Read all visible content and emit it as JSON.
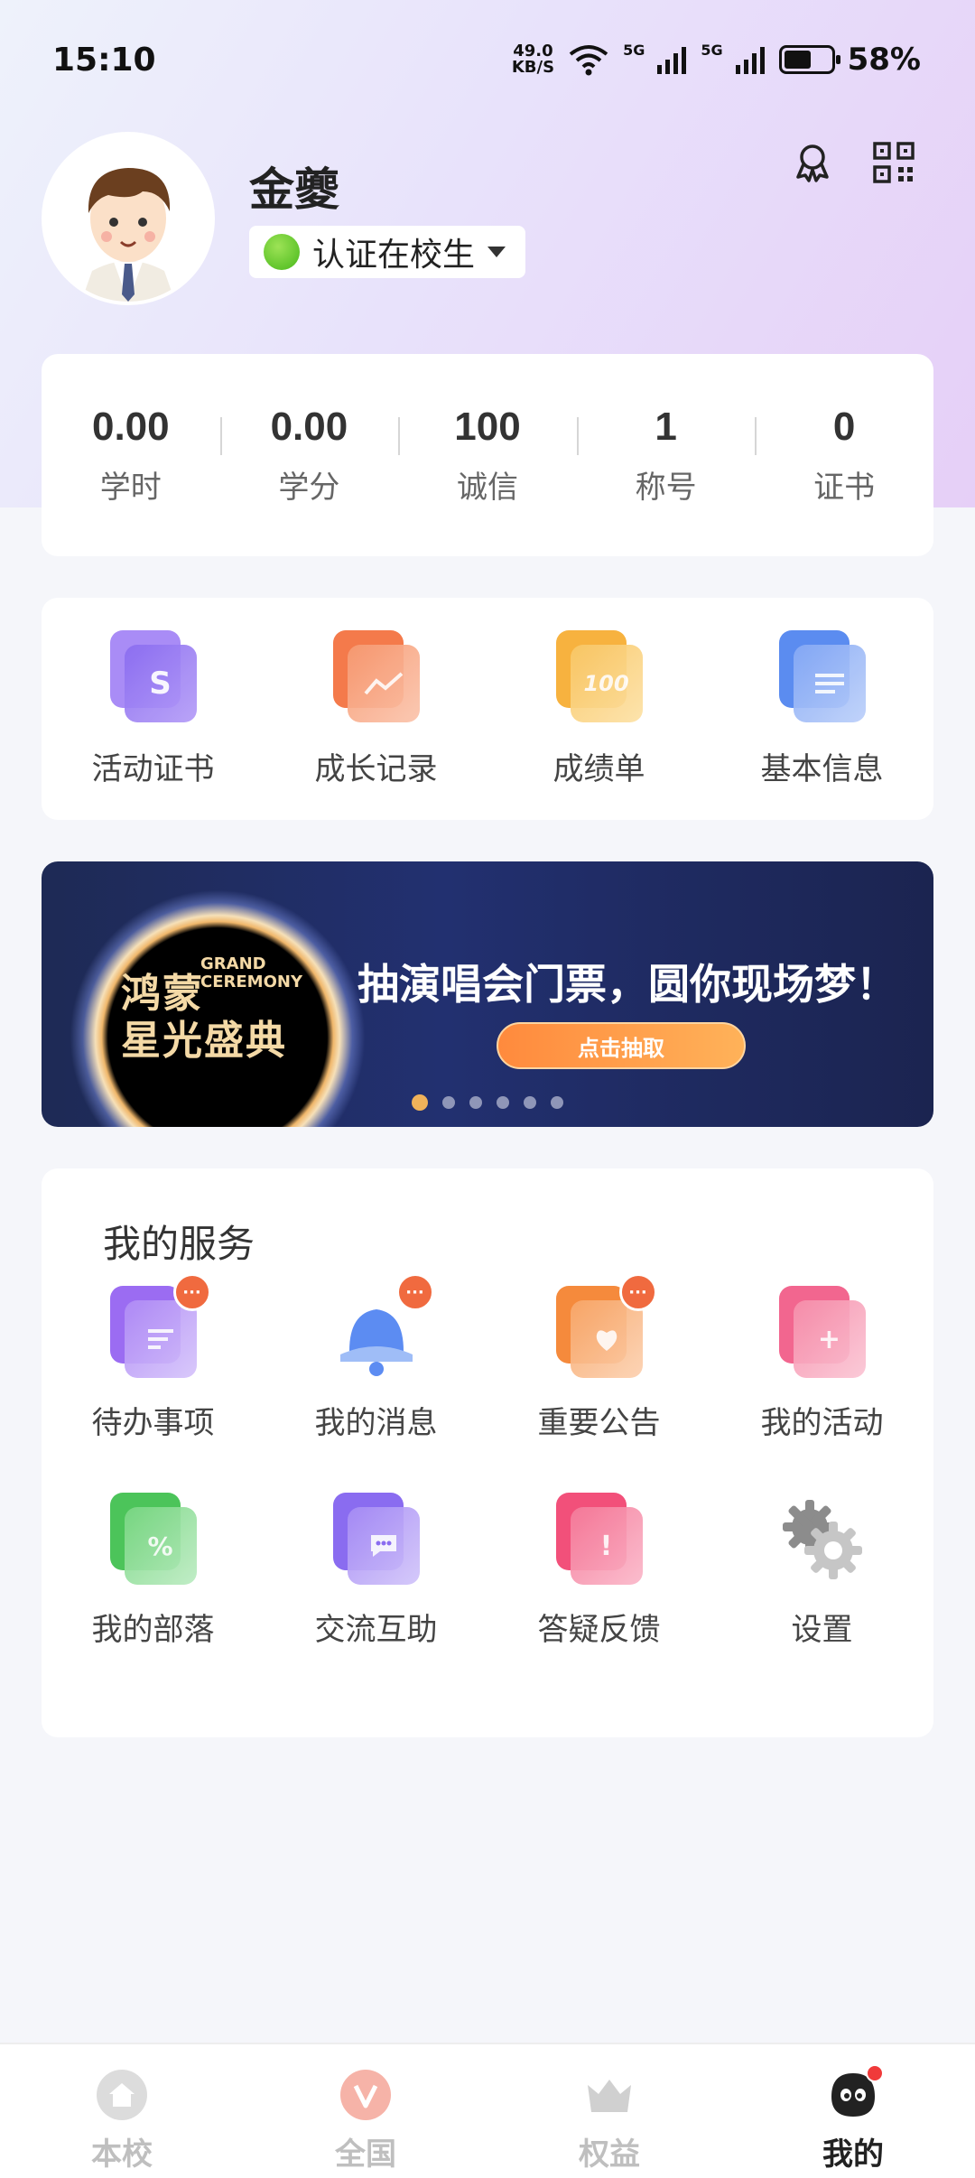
{
  "status_bar": {
    "time": "15:10",
    "net_speed_value": "49.0",
    "net_speed_unit": "KB/S",
    "signal1": "5G",
    "signal2": "5G",
    "battery_percent": "58%",
    "battery_level": 0.58
  },
  "profile": {
    "name": "金夔",
    "auth_status": "认证在校生"
  },
  "stats": [
    {
      "value": "0.00",
      "label": "学时"
    },
    {
      "value": "0.00",
      "label": "学分"
    },
    {
      "value": "100",
      "label": "诚信"
    },
    {
      "value": "1",
      "label": "称号"
    },
    {
      "value": "0",
      "label": "证书"
    }
  ],
  "quick_links": [
    {
      "label": "活动证书",
      "icon": "certificate-icon",
      "color": "#8a6cf0"
    },
    {
      "label": "成长记录",
      "icon": "growth-chart-icon",
      "color": "#f47a4b"
    },
    {
      "label": "成绩单",
      "icon": "score-100-icon",
      "color": "#f7b23f"
    },
    {
      "label": "基本信息",
      "icon": "info-doc-icon",
      "color": "#5b8cf0"
    }
  ],
  "banner": {
    "logo_line1": "鸿蒙",
    "logo_line2": "星光盛典",
    "logo_grand1": "GRAND",
    "logo_grand2": "CEREMONY",
    "headline": "抽演唱会门票，圆你现场梦！",
    "button": "点击抽取",
    "slide_count": 6,
    "active_slide": 1
  },
  "services": {
    "title": "我的服务",
    "items": [
      {
        "label": "待办事项",
        "icon": "todo-icon",
        "badge": "···",
        "color": "#9b6cf2"
      },
      {
        "label": "我的消息",
        "icon": "bell-icon",
        "badge": "···",
        "color": "#5c8cf2"
      },
      {
        "label": "重要公告",
        "icon": "announcement-icon",
        "badge": "···",
        "color": "#f58a3c"
      },
      {
        "label": "我的活动",
        "icon": "activity-icon",
        "badge": "",
        "color": "#f2668f"
      },
      {
        "label": "我的部落",
        "icon": "tribe-icon",
        "badge": "",
        "color": "#4cc45a"
      },
      {
        "label": "交流互助",
        "icon": "chat-icon",
        "badge": "",
        "color": "#8a6cf0"
      },
      {
        "label": "答疑反馈",
        "icon": "feedback-icon",
        "badge": "",
        "color": "#f2507a"
      },
      {
        "label": "设置",
        "icon": "gear-icon",
        "badge": "",
        "color": "#8c8c8c"
      }
    ]
  },
  "bottom_nav": [
    {
      "label": "本校",
      "icon": "home-icon",
      "active": false
    },
    {
      "label": "全国",
      "icon": "v-logo-icon",
      "active": false
    },
    {
      "label": "权益",
      "icon": "crown-icon",
      "active": false
    },
    {
      "label": "我的",
      "icon": "profile-face-icon",
      "active": true
    }
  ]
}
